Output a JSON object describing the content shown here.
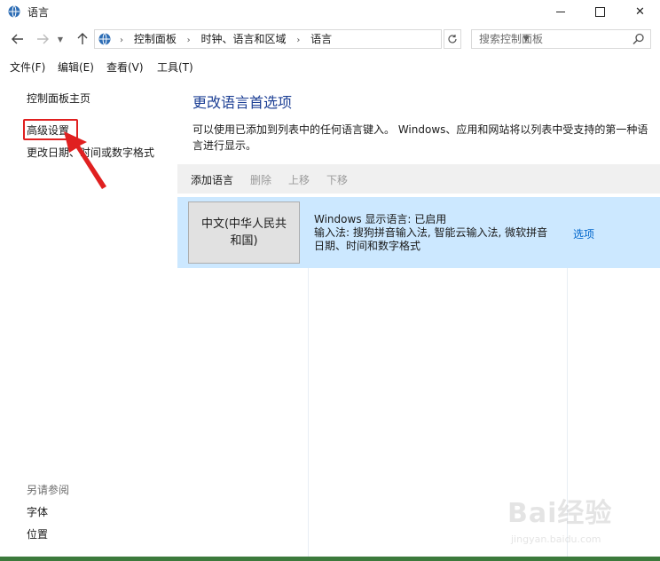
{
  "window": {
    "title": "语言"
  },
  "address": {
    "crumbs": [
      "控制面板",
      "时钟、语言和区域",
      "语言"
    ],
    "search_placeholder": "搜索控制面板"
  },
  "menu": [
    "文件(F)",
    "编辑(E)",
    "查看(V)",
    "工具(T)"
  ],
  "sidebar": {
    "home": "控制面板主页",
    "advanced": "高级设置",
    "datetime": "更改日期、时间或数字格式",
    "see_also": "另请参阅",
    "fonts": "字体",
    "location": "位置"
  },
  "main": {
    "title": "更改语言首选项",
    "description": "可以使用已添加到列表中的任何语言键入。 Windows、应用和网站将以列表中受支持的第一种语言进行显示。",
    "toolbar": {
      "add": "添加语言",
      "remove": "删除",
      "up": "上移",
      "down": "下移"
    },
    "language": {
      "name": "中文(中华人民共和国)",
      "line1": "Windows 显示语言: 已启用",
      "line2": "输入法: 搜狗拼音输入法, 智能云输入法, 微软拼音",
      "line3": "日期、时间和数字格式",
      "options": "选项"
    }
  },
  "colors": {
    "accent": "#1c3f94",
    "selection": "#cce8ff",
    "highlight": "#e02020",
    "link": "#0066cc"
  },
  "icons": {
    "app": "globe-clock-icon",
    "back": "arrow-left-icon",
    "forward": "arrow-right-icon",
    "up": "arrow-up-icon",
    "refresh": "refresh-icon",
    "search": "search-icon"
  }
}
